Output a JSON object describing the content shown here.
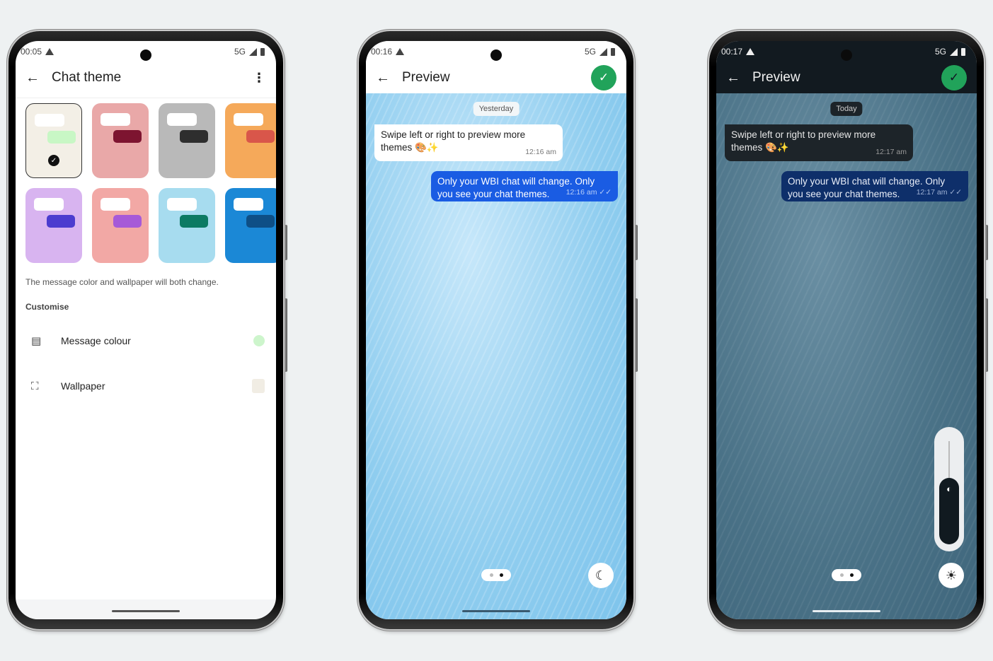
{
  "phones": [
    {
      "status": {
        "time": "00:05",
        "network": "5G"
      },
      "appbar": {
        "title": "Chat theme",
        "back_icon": "←",
        "more_icon": "⋮"
      },
      "themes": [
        {
          "name": "beige",
          "bg": "#f3efe6",
          "out_color": "#c8f7c5",
          "selected": true
        },
        {
          "name": "rose-plant",
          "bg": "#e9a8a8",
          "out_color": "#7d1430",
          "selected": false
        },
        {
          "name": "silver",
          "bg": "#b9b9b9",
          "out_color": "#2e2e2e",
          "selected": false
        },
        {
          "name": "orange",
          "bg": "#f5a95a",
          "out_color": "#d9564a",
          "selected": false
        },
        {
          "name": "lavender",
          "bg": "#d8b4f0",
          "out_color": "#4b3ccf",
          "selected": false
        },
        {
          "name": "pink-flower",
          "bg": "#f2a8a5",
          "out_color": "#a65ad8",
          "selected": false
        },
        {
          "name": "beach",
          "bg": "#a7dcef",
          "out_color": "#0c7a63",
          "selected": false
        },
        {
          "name": "blue-lines",
          "bg": "#1b88d6",
          "out_color": "#0e4f86",
          "selected": false
        }
      ],
      "selected_check_icon": "✓",
      "hint": "The message color and wallpaper will both change.",
      "section_title": "Customise",
      "rows": [
        {
          "label": "Message colour",
          "icon": "▤",
          "swatch": "#cdf5cc"
        },
        {
          "label": "Wallpaper",
          "icon": "⛶",
          "swatch": "#f1ede4"
        }
      ]
    },
    {
      "status": {
        "time": "00:16",
        "network": "5G"
      },
      "appbar": {
        "title": "Preview",
        "back_icon": "←",
        "confirm_icon": "✓"
      },
      "date_chip": "Yesterday",
      "incoming": {
        "text": "Swipe left or right to preview more themes 🎨✨",
        "time": "12:16 am"
      },
      "outgoing": {
        "text": "Only your WBI chat will change. Only you see your chat themes.",
        "time": "12:16 am ✓✓"
      },
      "pager": {
        "pages": 2,
        "current": 2
      },
      "mode_icon": "☾"
    },
    {
      "status": {
        "time": "00:17",
        "network": "5G"
      },
      "appbar": {
        "title": "Preview",
        "back_icon": "←",
        "confirm_icon": "✓"
      },
      "date_chip": "Today",
      "incoming": {
        "text": "Swipe left or right to preview more themes 🎨✨",
        "time": "12:17 am"
      },
      "outgoing": {
        "text": "Only your WBI chat will change. Only you see your chat themes.",
        "time": "12:17 am ✓✓"
      },
      "pager": {
        "pages": 2,
        "current": 2
      },
      "dimming_slider": {
        "icon": "◐",
        "level": 0.6
      },
      "mode_icon": "☀"
    }
  ],
  "colors": {
    "accent_green": "#21a35a",
    "outgoing_light": "#1a5ce3",
    "outgoing_dark": "#0e2f6a"
  }
}
